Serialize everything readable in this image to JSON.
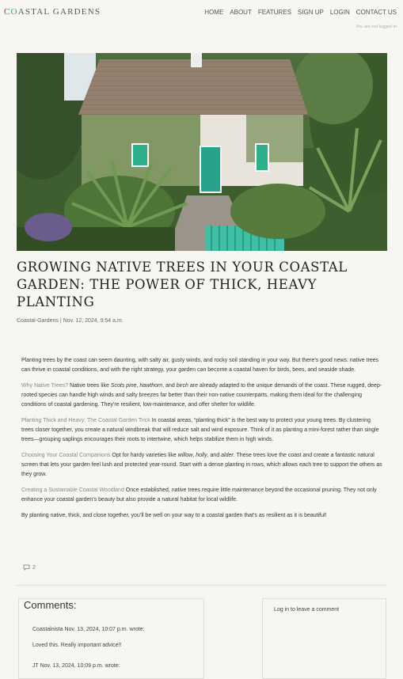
{
  "header": {
    "logo_prefix": "C",
    "logo_accent": "O",
    "logo_rest": "ASTAL GARDENS",
    "nav": [
      "HOME",
      "ABOUT",
      "FEATURES",
      "SIGN UP",
      "LOGIN",
      "CONTACT US"
    ],
    "login_status": "You are not logged in"
  },
  "post": {
    "title": "Growing Native Trees in Your Coastal Garden: The Power of Thick, Heavy Planting",
    "meta": "Coastal-Gardens | Nov. 12, 2024, 9:54 a.m.",
    "intro": "Planting trees by the coast can seem daunting, with salty air, gusty winds, and rocky soil standing in your way. But there’s good news: native trees can thrive in coastal conditions, and with the right strategy, your garden can become a coastal haven for birds, bees, and seaside shade.",
    "sections": [
      {
        "lead": "Why Native Trees?",
        "text_before": " Native trees like ",
        "i1": "Scots pine",
        "sep1": ", ",
        "i2": "hawthorn",
        "sep2": ", and ",
        "i3": "birch",
        "text_after": " are already adapted to the unique demands of the coast. These rugged, deep-rooted species can handle high winds and salty breezes far better than their non-native counterparts, making them ideal for the challenging conditions of coastal gardening. They’re resilient, low-maintenance, and offer shelter for wildlife."
      },
      {
        "lead": "Planting Thick and Heavy: The Coastal Garden Trick",
        "text": " In coastal areas, “planting thick” is the best way to protect your young trees. By clustering trees closer together, you create a natural windbreak that will reduce salt and wind exposure. Think of it as planting a mini-forest rather than single trees—grouping saplings encourages their roots to intertwine, which helps stabilize them in high winds."
      },
      {
        "lead": "Choosing Your Coastal Companions",
        "text_before": " Opt for hardy varieties like ",
        "i1": "willow",
        "sep1": ", ",
        "i2": "holly",
        "sep2": ", and ",
        "i3": "alder",
        "text_after": ". These trees love the coast and create a fantastic natural screen that lets your garden feel lush and protected year-round. Start with a dense planting in rows, which allows each tree to support the others as they grow."
      },
      {
        "lead": "Creating a Sustainable Coastal Woodland",
        "text": " Once established, native trees require little maintenance beyond the occasional pruning. They not only enhance your coastal garden’s beauty but also provide a natural habitat for local wildlife."
      }
    ],
    "closing": "By planting native, thick, and close together, you’ll be well on your way to a coastal garden that’s as resilient as it is beautiful!",
    "comment_count": "2"
  },
  "comments": {
    "heading": "Comments:",
    "items": [
      {
        "meta": "Coastalnista Nov. 13, 2024, 10:07 p.m. wrote:",
        "body": "Loved this. Really important advice!!"
      },
      {
        "meta": "JT Nov. 13, 2024, 10:09 p.m. wrote:"
      }
    ],
    "login_prompt": "Log in to leave a comment"
  },
  "icons": {
    "comment": "comment-bubble-icon"
  },
  "colors": {
    "accent": "#2a9d8f",
    "background": "#f7f6f3"
  }
}
